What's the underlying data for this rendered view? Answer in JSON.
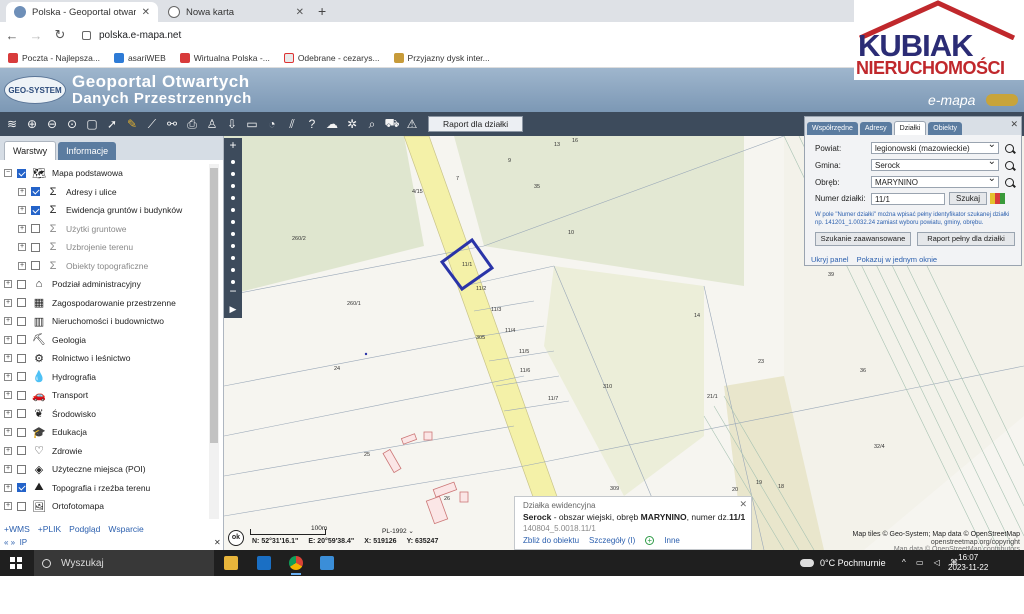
{
  "browser": {
    "tabs": [
      {
        "title": "Polska - Geoportal otwartych da",
        "active": true
      },
      {
        "title": "Nowa karta",
        "active": false
      }
    ],
    "url": "polska.e-mapa.net",
    "bookmarks": [
      "Poczta - Najlepsza...",
      "asariWEB",
      "Wirtualna Polska -...",
      "Odebrane - cezarys...",
      "Przyjazny dysk inter..."
    ]
  },
  "logo": {
    "line1": "KUBIAK",
    "line2": "NIERUCHOMOŚCI"
  },
  "header": {
    "badge": "GEO-SYSTEM",
    "title1": "Geoportal Otwartych",
    "title2": "Danych Przestrzennych",
    "brand": "e-mapa"
  },
  "map_toolbar": {
    "raport_button": "Raport dla działki"
  },
  "left_panel": {
    "tabs": [
      "Warstwy",
      "Informacje"
    ],
    "layers": [
      {
        "label": "Mapa podstawowa",
        "checked": true,
        "level": 0,
        "icon": "map-icon",
        "dim": false
      },
      {
        "label": "Adresy i ulice",
        "checked": true,
        "level": 1,
        "icon": "sigma-icon",
        "dim": false
      },
      {
        "label": "Ewidencja gruntów i budynków",
        "checked": true,
        "level": 1,
        "icon": "sigma-icon",
        "dim": false
      },
      {
        "label": "Użytki gruntowe",
        "checked": false,
        "level": 1,
        "icon": "sigma-icon",
        "dim": true
      },
      {
        "label": "Uzbrojenie terenu",
        "checked": false,
        "level": 1,
        "icon": "sigma-icon",
        "dim": true
      },
      {
        "label": "Obiekty topograficzne",
        "checked": false,
        "level": 1,
        "icon": "sigma-icon",
        "dim": true
      },
      {
        "label": "Podział administracyjny",
        "checked": false,
        "level": 0,
        "icon": "admin-icon",
        "dim": false
      },
      {
        "label": "Zagospodarowanie przestrzenne",
        "checked": false,
        "level": 0,
        "icon": "zoning-icon",
        "dim": false
      },
      {
        "label": "Nieruchomości i budownictwo",
        "checked": false,
        "level": 0,
        "icon": "building-icon",
        "dim": false
      },
      {
        "label": "Geologia",
        "checked": false,
        "level": 0,
        "icon": "geology-icon",
        "dim": false
      },
      {
        "label": "Rolnictwo i leśnictwo",
        "checked": false,
        "level": 0,
        "icon": "tractor-icon",
        "dim": false
      },
      {
        "label": "Hydrografia",
        "checked": false,
        "level": 0,
        "icon": "water-icon",
        "dim": false
      },
      {
        "label": "Transport",
        "checked": false,
        "level": 0,
        "icon": "car-icon",
        "dim": false
      },
      {
        "label": "Środowisko",
        "checked": false,
        "level": 0,
        "icon": "leaf-icon",
        "dim": false
      },
      {
        "label": "Edukacja",
        "checked": false,
        "level": 0,
        "icon": "education-icon",
        "dim": false
      },
      {
        "label": "Zdrowie",
        "checked": false,
        "level": 0,
        "icon": "heart-icon",
        "dim": false
      },
      {
        "label": "Użyteczne miejsca (POI)",
        "checked": false,
        "level": 0,
        "icon": "poi-icon",
        "dim": false
      },
      {
        "label": "Topografia i rzeźba terenu",
        "checked": true,
        "level": 0,
        "icon": "topo-icon",
        "dim": false
      },
      {
        "label": "Ortofotomapa",
        "checked": false,
        "level": 0,
        "icon": "ortho-icon",
        "dim": false
      }
    ],
    "links": [
      "+WMS",
      "+PLIK",
      "Podgląd",
      "Wsparcie"
    ],
    "ip_label": "IP"
  },
  "search_panel": {
    "tabs": [
      "Współrzędne",
      "Adresy",
      "Działki",
      "Obiekty"
    ],
    "active_tab": "Działki",
    "powiat_label": "Powiat:",
    "powiat_value": "legionowski (mazowieckie)",
    "gmina_label": "Gmina:",
    "gmina_value": "Serock",
    "obreb_label": "Obręb:",
    "obreb_value": "MARYNINO",
    "numer_label": "Numer działki:",
    "numer_value": "11/1",
    "search_button": "Szukaj",
    "hint": "W pole \"Numer działki\" można wpisać pełny identyfikator szukanej działki np. 141201_1.0032.24 zamiast wyboru powiatu, gminy, obrębu.",
    "advanced_button": "Szukanie zaawansowane",
    "report_button": "Raport pełny dla działki",
    "hide_link": "Ukryj panel",
    "show_one_window_link": "Pokazuj w jednym oknie"
  },
  "popup": {
    "title": "Działka ewidencyjna",
    "gmina": "Serock",
    "location_text": " - obszar wiejski, obręb ",
    "obreb": "MARYNINO",
    "number_text": ", numer dz.",
    "number": "11/1",
    "id": "140804_5.0018.11/1",
    "actions": [
      "Zbliż do obiektu",
      "Szczegóły (I)",
      "Inne"
    ]
  },
  "status": {
    "ok": "ok",
    "scale_label": "100m",
    "crs": "PL-1992",
    "n": "N: 52°31'16.1\"",
    "e": "E: 20°59'38.4\"",
    "x": "X: 519126",
    "y": "Y: 635247",
    "attribution1": "Map tiles © Geo-System; Map data © OpenStreetMap",
    "attribution2": "openstreetmap.org/copyright",
    "attribution3": "Map data © OpenStreetMap contributors"
  },
  "map_labels": [
    "13",
    "16",
    "9",
    "7",
    "4/15",
    "35",
    "260/2",
    "10",
    "11/1",
    "11/2",
    "260/1",
    "11/3",
    "11/4",
    "305",
    "11/5",
    "14",
    "11/6",
    "24",
    "310",
    "11/7",
    "21/1",
    "23",
    "36",
    "25",
    "32/4",
    "26",
    "309",
    "20",
    "19",
    "18",
    "39"
  ],
  "taskbar": {
    "search": "Wyszukaj",
    "weather": "0°C  Pochmurnie",
    "time": "16:07",
    "date": "2023-11-22"
  },
  "colors": {
    "parcel_highlight": "#2a34a8",
    "header_blue": "#7c98b5",
    "tool_bar": "#3d4b5c",
    "road": "#f4f1a8"
  }
}
